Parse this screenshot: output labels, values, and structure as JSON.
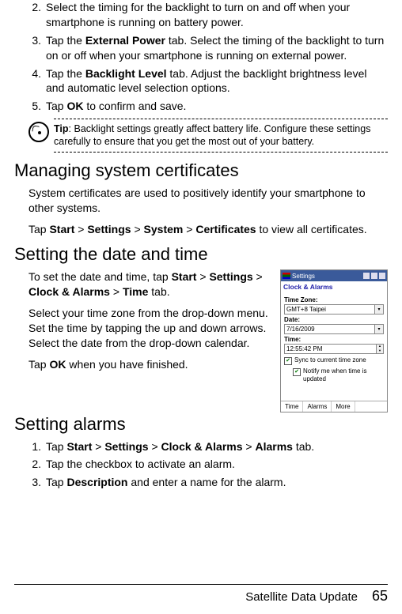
{
  "steps_a": [
    {
      "n": "2.",
      "pre": "Select the timing for the backlight to turn on and off when your smartphone is running on battery power."
    },
    {
      "n": "3.",
      "pre": "Tap the ",
      "b1": "External Power",
      "post": " tab. Select the timing of the back­light to turn on or off when your smartphone is running on external power."
    },
    {
      "n": "4.",
      "pre": "Tap the ",
      "b1": "Backlight Level",
      "post": " tab. Adjust the backlight brightness level and automatic level selection options."
    },
    {
      "n": "5.",
      "pre": "Tap ",
      "b1": "OK",
      "post": " to confirm and save."
    }
  ],
  "tip": {
    "label": "Tip",
    "text": ": Backlight settings greatly affect battery life. Configure these set­tings carefully to ensure that you get the most out of your battery."
  },
  "h_cert": "Managing system certificates",
  "cert_p1": "System certificates are used to positively identify your smart­phone to other systems.",
  "cert_p2": {
    "pre": "Tap ",
    "s": "Start",
    "g1": " > ",
    "se": "Settings",
    "g2": " > ",
    "sy": "System",
    "g3": " > ",
    "c": "Certificates",
    "post": " to view all certificates."
  },
  "h_time": "Setting the date and time",
  "time_p1": {
    "pre": "To set the date and time, tap ",
    "s": "Start",
    "g1": " > ",
    "se": "Set­tings",
    "g2": " > ",
    "ca": "Clock & Alarms",
    "g3": " > ",
    "t": "Time",
    "post": " tab."
  },
  "time_p2": "Select your time zone from the drop-down menu. Set the time by tapping the up and down arrows. Select the date from the drop-down calendar.",
  "time_p3": {
    "pre": "Tap ",
    "ok": "OK",
    "post": " when you have finished."
  },
  "h_alarm": "Setting alarms",
  "alarm_steps": [
    {
      "n": "1.",
      "pre": "Tap ",
      "s": "Start",
      "g1": " > ",
      "se": "Settings",
      "g2": " > ",
      "ca": "Clock & Alarms",
      "g3": " > ",
      "a": "Alarms",
      "post": " tab."
    },
    {
      "n": "2.",
      "pre": "Tap the checkbox to activate an alarm."
    },
    {
      "n": "3.",
      "pre": "Tap ",
      "d": "Description",
      "post": " and enter a name for the alarm."
    }
  ],
  "phone": {
    "title": "Settings",
    "tab": "Clock & Alarms",
    "tz_lbl": "Time Zone:",
    "tz_val": "GMT+8 Taipei",
    "date_lbl": "Date:",
    "date_val": "7/16/2009",
    "time_lbl": "Time:",
    "time_val": "12:55:42 PM",
    "sync": "Sync to current time zone",
    "notify": "Notify me when time is updated",
    "bot": [
      "Time",
      "Alarms",
      "More"
    ]
  },
  "footer": {
    "title": "Satellite Data Update",
    "page": "65"
  }
}
